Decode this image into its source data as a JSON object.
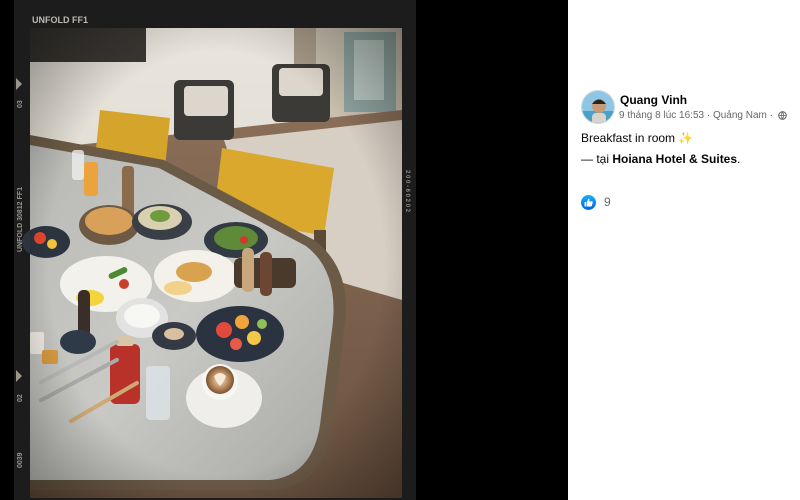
{
  "photo": {
    "film_brand": "UNFOLD FF1",
    "edge_code_top": "2 0 0 - 6 0 2 0 2",
    "edge_code_left": "UNFOLD 30812 FF1",
    "frame_03": "03",
    "frame_02": "02",
    "frame_0039": "0039"
  },
  "post": {
    "author": "Quang Vinh",
    "date": "9 tháng 8 lúc 16:53",
    "separator": " · ",
    "location": "Quảng Nam",
    "caption": "Breakfast in room",
    "caption_emoji": "✨",
    "checkin_prefix": "— tại ",
    "checkin_place": "Hoiana Hotel & Suites",
    "checkin_suffix": ".",
    "reaction_count": "9",
    "reaction_type": "like-icon"
  },
  "colors": {
    "viewer_bg": "#000000",
    "panel_bg": "#ffffff",
    "name_color": "#050505",
    "meta_color": "#65676b",
    "like_blue": "#0866ff"
  }
}
